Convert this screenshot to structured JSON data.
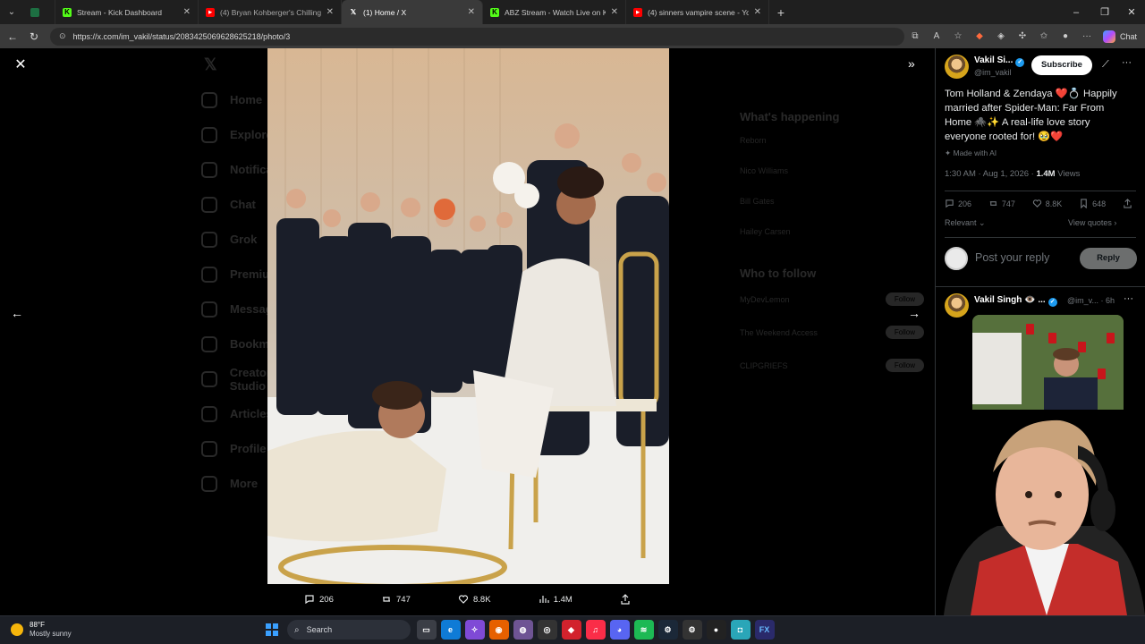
{
  "browser": {
    "tabs": [
      {
        "label": "",
        "icon": "excel-sheet-icon",
        "color": "#1d6f42",
        "active": false
      },
      {
        "label": "Stream - Kick Dashboard",
        "icon": "kick-logo-icon",
        "color": "#53fc18",
        "active": false
      },
      {
        "label": "(4) Bryan Kohberger's Chilling Mo",
        "icon": "youtube-icon",
        "color": "#ff0000",
        "active": false
      },
      {
        "label": "(1) Home / X",
        "icon": "x-logo-icon",
        "color": "#ffffff",
        "active": true
      },
      {
        "label": "ABZ Stream - Watch Live on Kick",
        "icon": "kick-logo-icon",
        "color": "#53fc18",
        "active": false
      },
      {
        "label": "(4) sinners vampire scene - YouTu",
        "icon": "youtube-icon",
        "color": "#ff0000",
        "active": false
      }
    ],
    "url": "https://x.com/im_vakil/status/2083425069628625218/photo/3",
    "chat_label": "Chat"
  },
  "underlay": {
    "nav": [
      "Home",
      "Explore",
      "Notifications",
      "Chat",
      "Grok",
      "Premium",
      "Messages",
      "Bookmarks",
      "Creator Studio",
      "Articles",
      "Profile",
      "More"
    ],
    "whats_happening": "What's happening",
    "trends": [
      "Reborn",
      "Nico Williams",
      "Bill Gates",
      "Hailey Carsen"
    ],
    "who_to_follow": "Who to follow",
    "follow_suggestions": [
      "MyDevLemon",
      "The Weekend Access",
      "CLIPGRIEFS"
    ],
    "follow_label": "Follow"
  },
  "media_actions": {
    "replies": "206",
    "reposts": "747",
    "likes": "8.8K",
    "views": "1.4M"
  },
  "tweet": {
    "author_name": "Vakil Si...",
    "handle": "@im_vakil",
    "subscribe_label": "Subscribe",
    "text": "Tom Holland & Zendaya ❤️💍 Happily married after Spider-Man: Far From Home 🕷️✨ A real-life love story everyone rooted for! 🥹❤️",
    "ai_label": "Made with AI",
    "time": "1:30 AM · Aug 1, 2026 · ",
    "views_count": "1.4M",
    "views_label": " Views",
    "stats": {
      "replies": "206",
      "reposts": "747",
      "likes": "8.8K",
      "bookmarks": "648"
    },
    "sort_label": "Relevant",
    "quotes_label": "View quotes",
    "reply_placeholder": "Post your reply",
    "reply_button": "Reply"
  },
  "reply_post": {
    "author_name": "Vakil Singh 👁️ ...",
    "handle_time": "@im_v... · 6h"
  },
  "taskbar": {
    "temperature": "88°F",
    "condition": "Mostly sunny",
    "search_placeholder": "Search"
  }
}
